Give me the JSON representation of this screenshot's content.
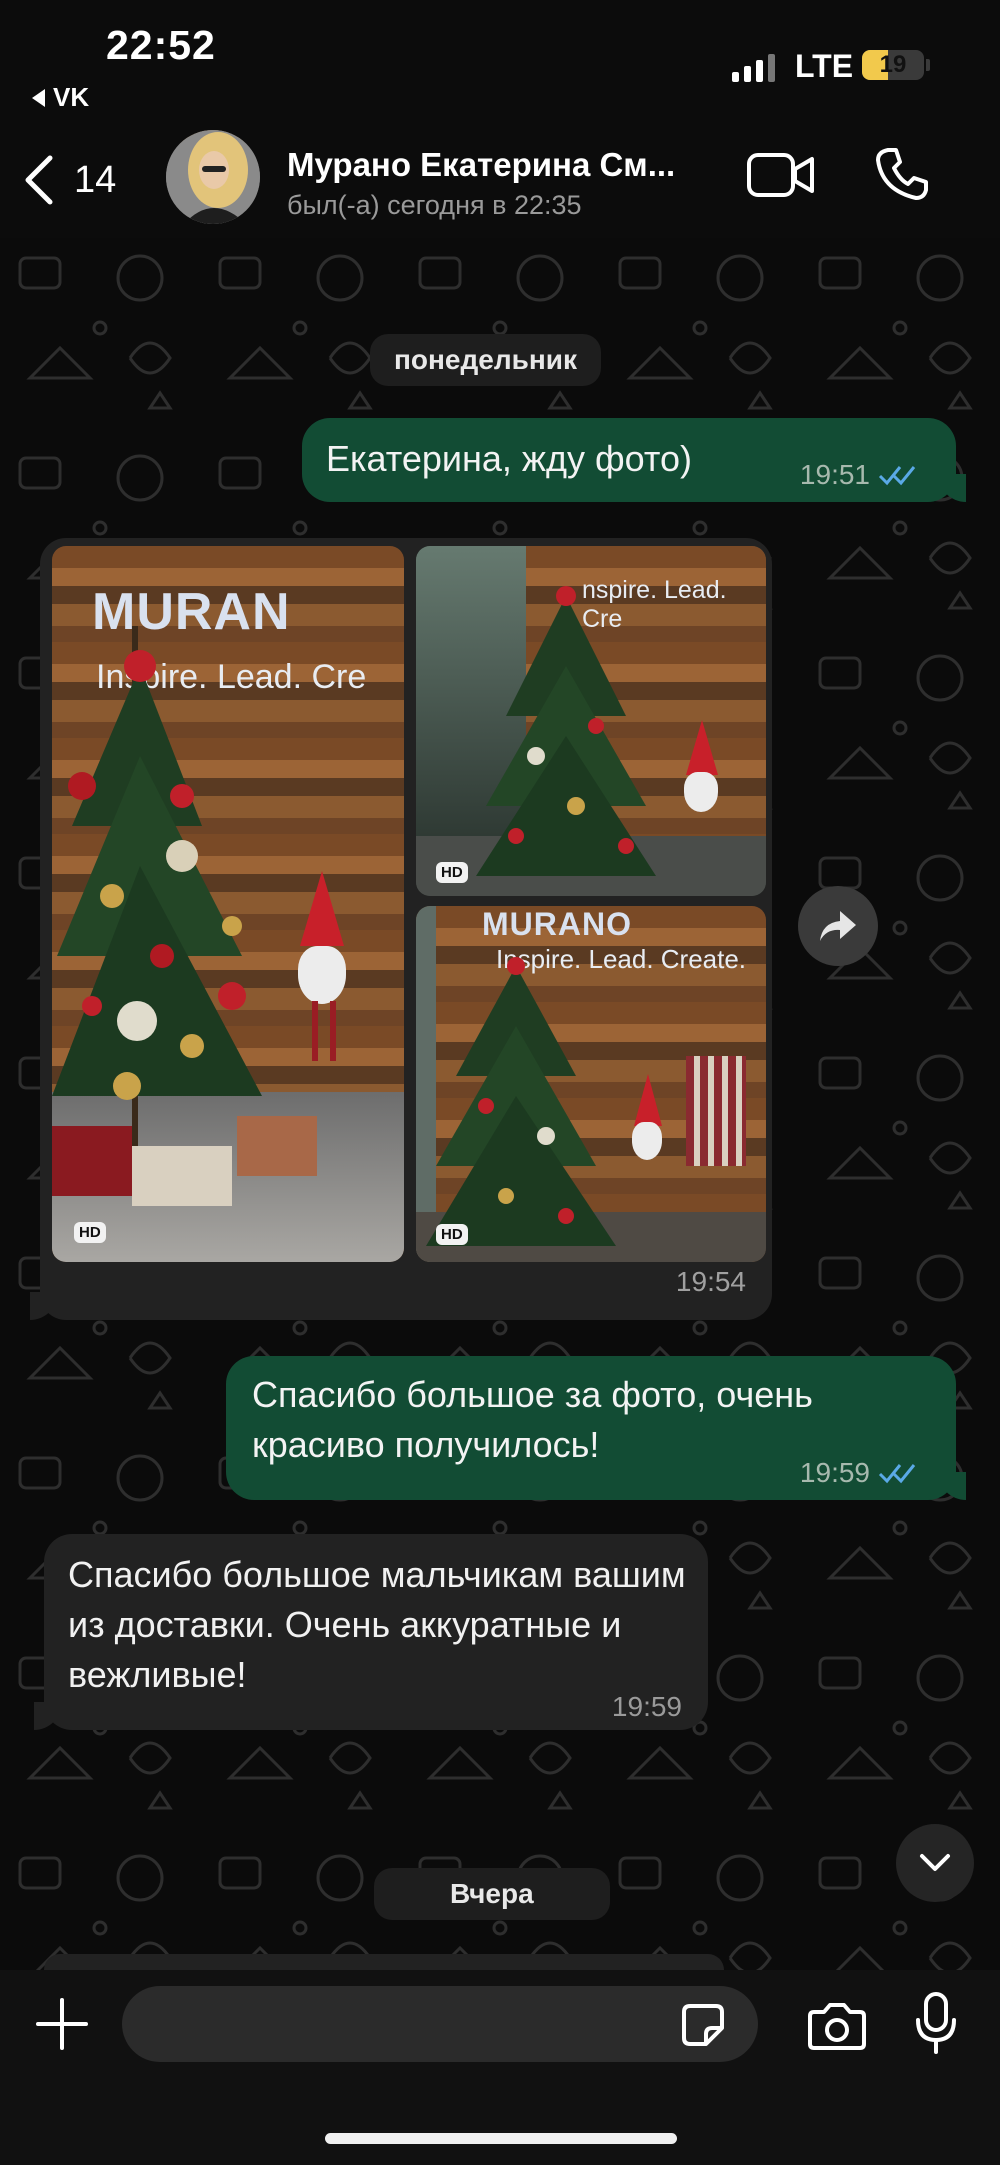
{
  "status_bar": {
    "time": "22:52",
    "back_app": "VK",
    "network": "LTE",
    "battery": "19",
    "battery_level": 0.19
  },
  "header": {
    "back_count": "14",
    "contact_name": "Мурано Екатерина См...",
    "contact_status": "был(-а) сегодня в 22:35",
    "icons": [
      "chevron-left-icon",
      "video-call-icon",
      "phone-icon"
    ]
  },
  "chat": {
    "date_monday": "понедельник",
    "date_yesterday": "Вчера",
    "messages": [
      {
        "direction": "out",
        "text": "Екатерина, жду фото)",
        "time": "19:51",
        "read": true
      },
      {
        "direction": "in",
        "type": "album",
        "photo_count": 3,
        "time": "19:54",
        "badge": "HD"
      },
      {
        "direction": "out",
        "text": "Спасибо большое за фото, очень красиво получилось!",
        "time": "19:59",
        "read": true
      },
      {
        "direction": "in",
        "text": "Спасибо большое мальчикам вашим из доставки. Очень аккуратные и вежливые!",
        "time": "19:59"
      }
    ],
    "album": {
      "logo": "MURAN",
      "logo_full": "MURANO",
      "slogan_partial": "Inspire. Lead. Cre",
      "slogan": "Inspire. Lead. Create.",
      "slogan_cut": "nspire. Lead. Cre"
    }
  },
  "input_bar": {
    "placeholder": "",
    "icons": [
      "plus-icon",
      "sticker-icon",
      "camera-icon",
      "microphone-icon"
    ]
  },
  "colors": {
    "outgoing_bubble": "#124c34",
    "incoming_bubble": "#222222",
    "read_ticks": "#5aa9e6",
    "background": "#0b0b0b"
  }
}
